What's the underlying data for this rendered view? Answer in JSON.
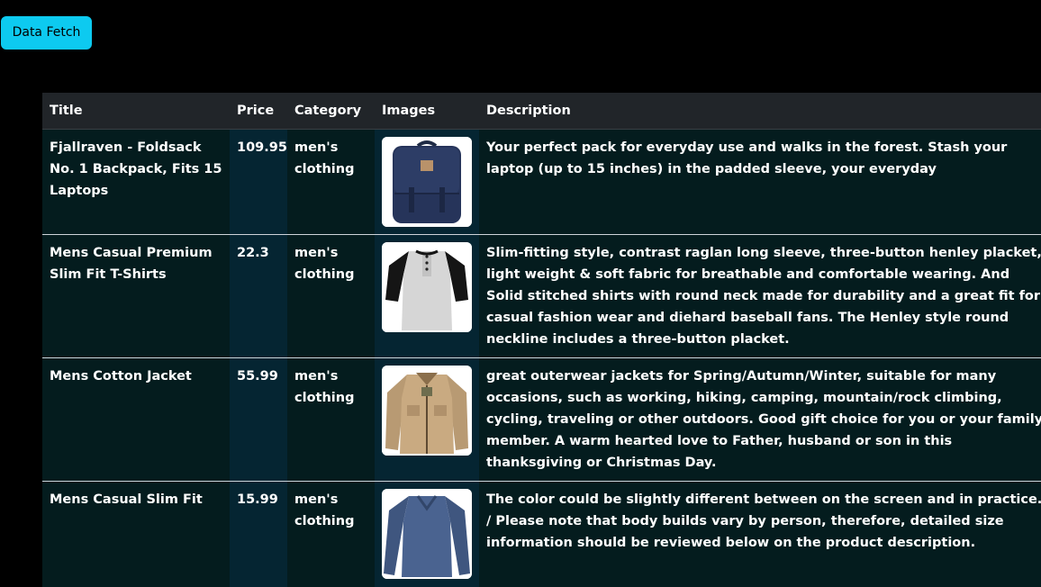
{
  "toolbar": {
    "fetch_label": "Data Fetch"
  },
  "table": {
    "headers": [
      "Title",
      "Price",
      "Category",
      "Images",
      "Description"
    ],
    "rows": [
      {
        "title": "Fjallraven - Foldsack No. 1 Backpack, Fits 15 Laptops",
        "price": "109.95",
        "category": "men's clothing",
        "image": "backpack-image",
        "description": "Your perfect pack for everyday use and walks in the forest. Stash your laptop (up to 15 inches) in the padded sleeve, your everyday"
      },
      {
        "title": "Mens Casual Premium Slim Fit T-Shirts",
        "price": "22.3",
        "category": "men's clothing",
        "image": "raglan-shirt-image",
        "description": "Slim-fitting style, contrast raglan long sleeve, three-button henley placket, light weight & soft fabric for breathable and comfortable wearing. And Solid stitched shirts with round neck made for durability and a great fit for casual fashion wear and diehard baseball fans. The Henley style round neckline includes a three-button placket."
      },
      {
        "title": "Mens Cotton Jacket",
        "price": "55.99",
        "category": "men's clothing",
        "image": "cotton-jacket-image",
        "description": "great outerwear jackets for Spring/Autumn/Winter, suitable for many occasions, such as working, hiking, camping, mountain/rock climbing, cycling, traveling or other outdoors. Good gift choice for you or your family member. A warm hearted love to Father, husband or son in this thanksgiving or Christmas Day."
      },
      {
        "title": "Mens Casual Slim Fit",
        "price": "15.99",
        "category": "men's clothing",
        "image": "long-sleeve-tee-image",
        "description": "The color could be slightly different between on the screen and in practice. / Please note that body builds vary by person, therefore, detailed size information should be reviewed below on the product description."
      }
    ]
  },
  "colors": {
    "button": "#0dcaf0",
    "header_bg": "#212529",
    "row_bg": "#041c1e",
    "highlight_col_bg": "#052532"
  }
}
